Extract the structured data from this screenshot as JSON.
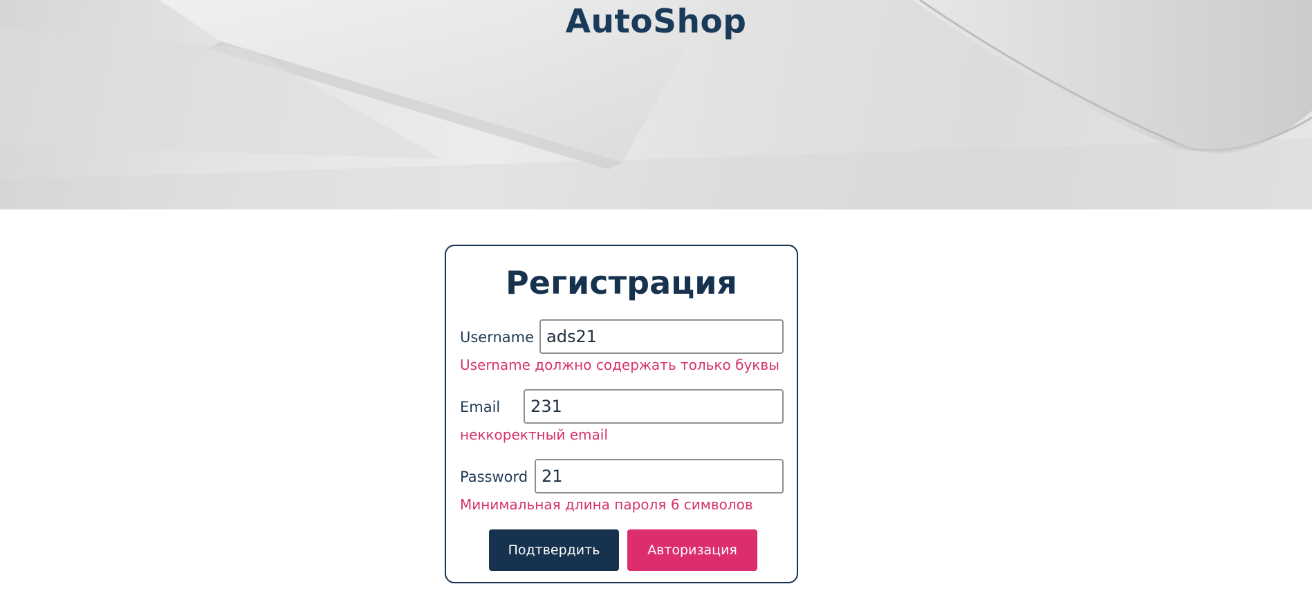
{
  "header": {
    "site_title": "AutoShop"
  },
  "form": {
    "title": "Регистрация",
    "fields": [
      {
        "label": "Username",
        "value": "ads21",
        "error": "Username должно содержать только буквы"
      },
      {
        "label": "Email",
        "value": "231",
        "error": "неккоректный email"
      },
      {
        "label": "Password",
        "value": "21",
        "error": "Минимальная длина пароля 6 символов"
      }
    ],
    "submit_label": "Подтвердить",
    "login_label": "Авторизация"
  },
  "colors": {
    "primary": "#16324f",
    "accent": "#dc2d6e",
    "error": "#d6336c"
  }
}
